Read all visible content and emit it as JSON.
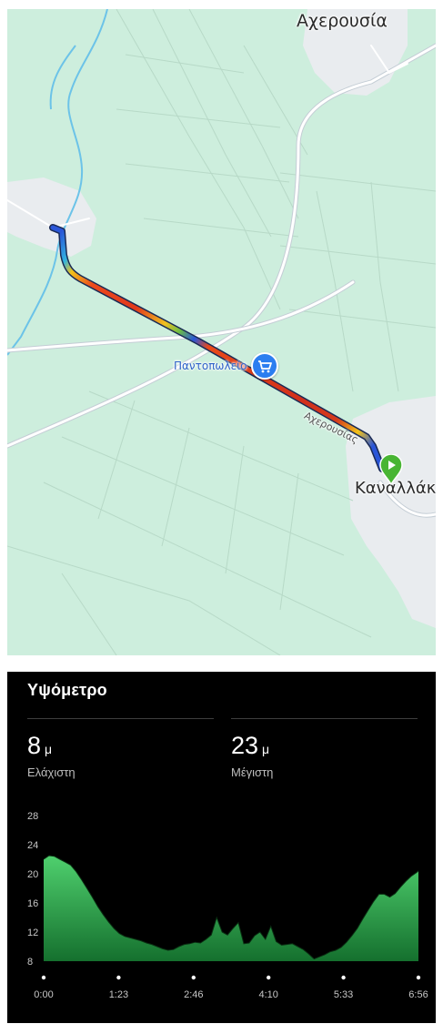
{
  "map": {
    "labels": {
      "north_village": "Αχερουσία",
      "town": "Καναλλάκι",
      "shop": "Παντοπωλείο",
      "road": "Αχερουσίας"
    },
    "icons": {
      "shop": "shopping-cart-icon",
      "start": "play-icon"
    },
    "colors": {
      "land": "#cdeedd",
      "urban": "#e9ecef",
      "water": "#6cc3e8",
      "route_start": "#2a56d8"
    }
  },
  "elevation": {
    "title": "Υψόμετρο",
    "min": {
      "value": "8",
      "unit": "μ",
      "label": "Ελάχιστη"
    },
    "max": {
      "value": "23",
      "unit": "μ",
      "label": "Μέγιστη"
    }
  },
  "chart_data": {
    "type": "area",
    "x_tick_labels": [
      "0:00",
      "1:23",
      "2:46",
      "4:10",
      "5:33",
      "6:56"
    ],
    "y_tick_labels": [
      "28",
      "24",
      "20",
      "16",
      "12",
      "8"
    ],
    "ylim": [
      8,
      28
    ],
    "xlim_minutes": [
      0,
      6.93
    ],
    "grid": false,
    "series": [
      {
        "x_minutes": [
          0,
          0.1,
          0.2,
          0.3,
          0.4,
          0.5,
          0.6,
          0.7,
          0.8,
          0.9,
          1.0,
          1.1,
          1.2,
          1.3,
          1.4,
          1.5,
          1.6,
          1.7,
          1.8,
          1.9,
          2.0,
          2.1,
          2.2,
          2.3,
          2.4,
          2.5,
          2.6,
          2.7,
          2.8,
          2.9,
          3.0,
          3.1,
          3.2,
          3.3,
          3.4,
          3.5,
          3.6,
          3.7,
          3.8,
          3.9,
          4.0,
          4.1,
          4.2,
          4.3,
          4.4,
          4.5,
          4.6,
          4.7,
          4.8,
          4.9,
          5.0,
          5.1,
          5.2,
          5.3,
          5.4,
          5.5,
          5.6,
          5.7,
          5.8,
          5.9,
          6.0,
          6.1,
          6.2,
          6.3,
          6.4,
          6.5,
          6.6,
          6.7,
          6.8,
          6.9,
          6.93
        ],
        "y": [
          22,
          22.5,
          22.4,
          22.0,
          21.6,
          21.2,
          20.3,
          19.2,
          18.0,
          16.8,
          15.5,
          14.4,
          13.4,
          12.5,
          11.8,
          11.4,
          11.2,
          11.0,
          10.8,
          10.5,
          10.3,
          10.0,
          9.7,
          9.5,
          9.6,
          10.0,
          10.3,
          10.4,
          10.6,
          10.5,
          11.0,
          11.6,
          14.0,
          12.0,
          11.6,
          12.5,
          13.3,
          10.4,
          10.5,
          11.5,
          12.0,
          11.0,
          12.8,
          10.7,
          10.2,
          10.3,
          10.4,
          10.0,
          9.6,
          9.0,
          8.3,
          8.6,
          8.9,
          9.3,
          9.5,
          9.9,
          10.6,
          11.5,
          12.5,
          13.8,
          15.0,
          16.2,
          17.2,
          17.2,
          16.8,
          17.3,
          18.2,
          19.0,
          19.7,
          20.2,
          20.4
        ]
      }
    ],
    "colors": {
      "fill_top": "#4fd06e",
      "fill_bottom": "#15702e",
      "background": "#000000"
    }
  }
}
